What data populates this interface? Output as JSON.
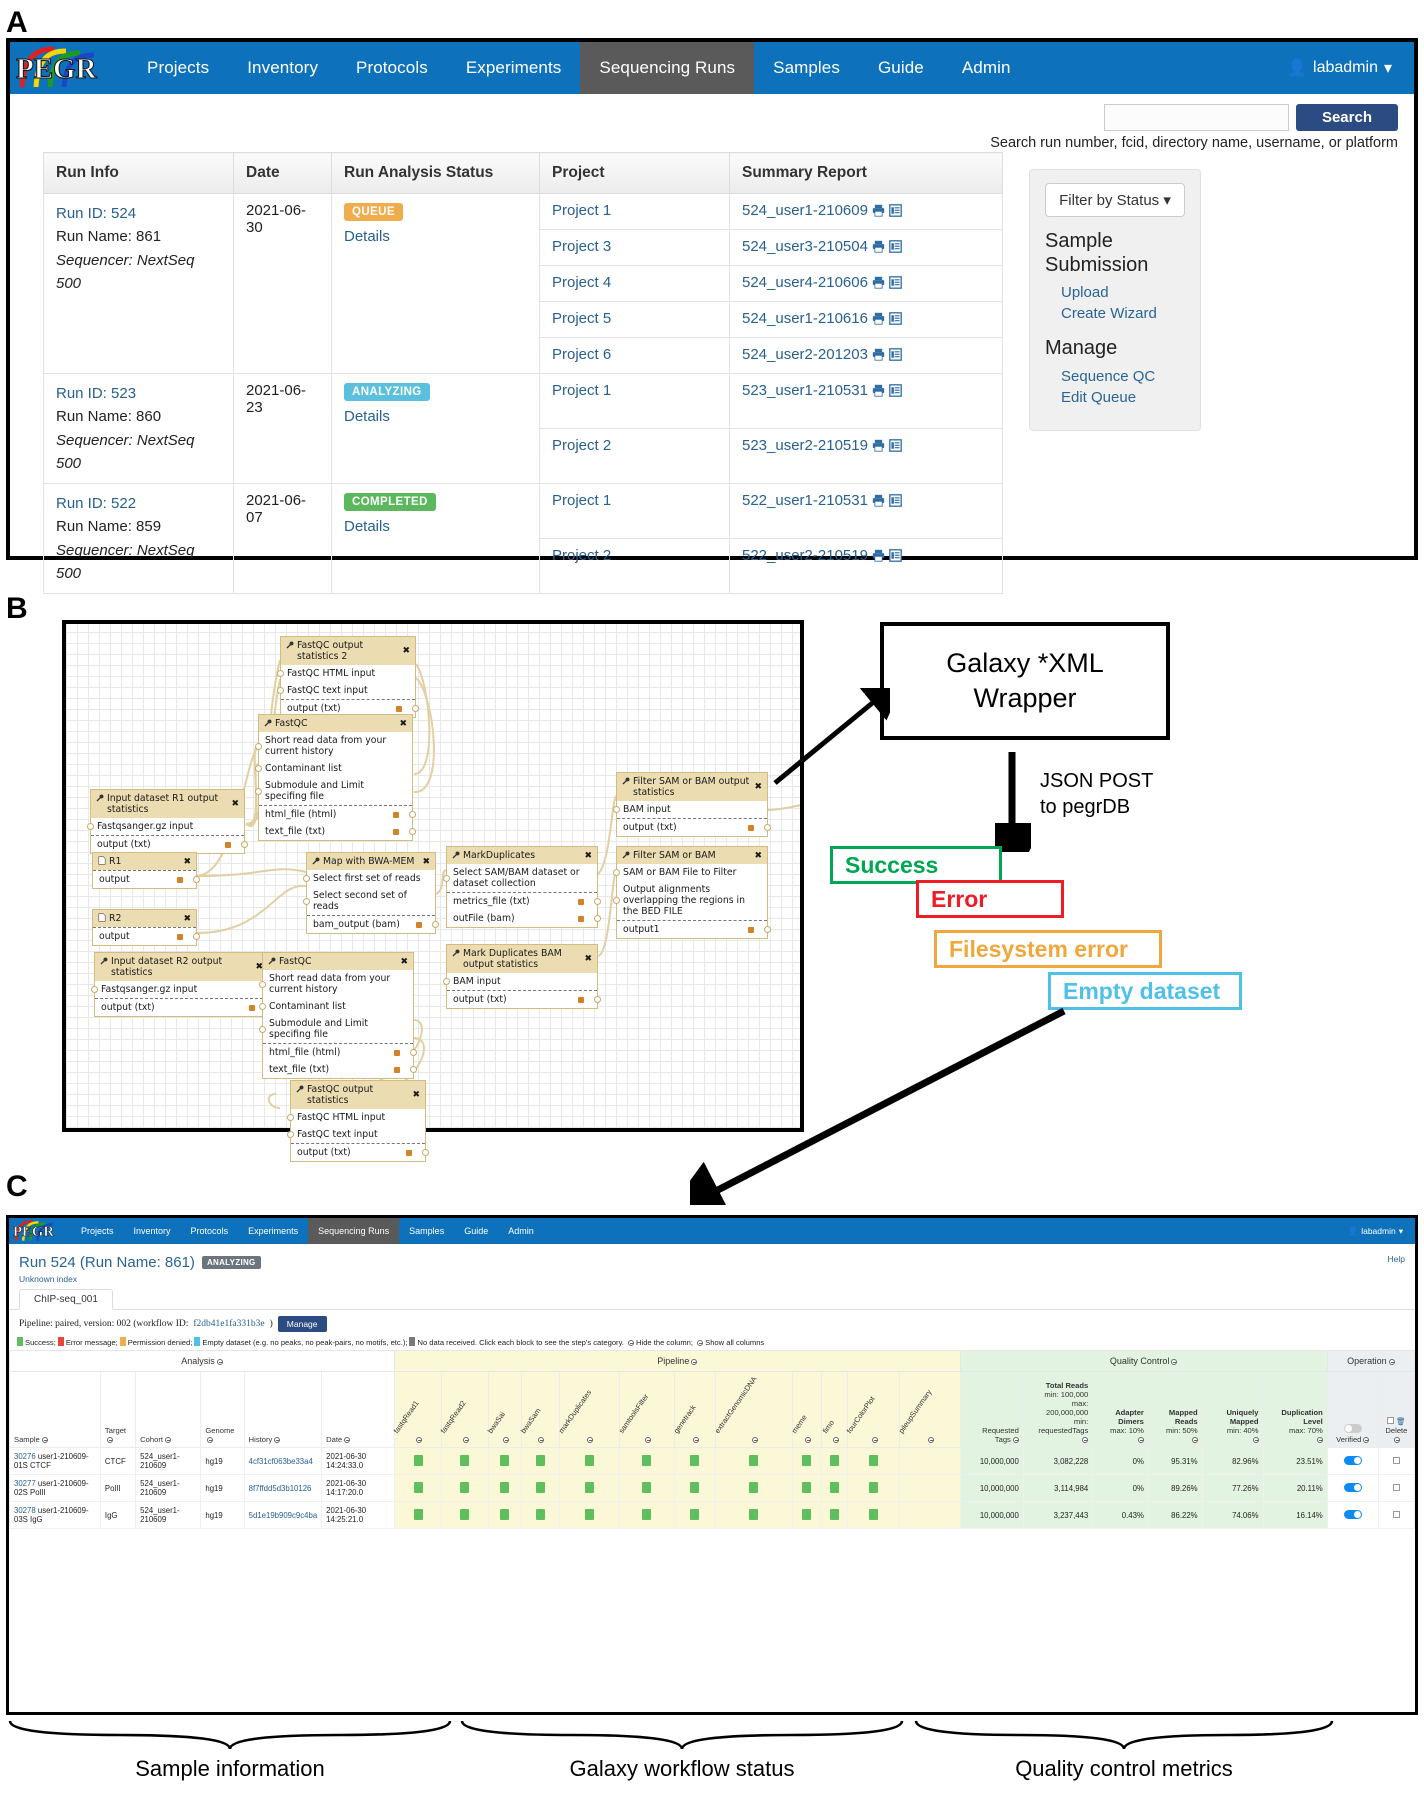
{
  "panels": {
    "a": "A",
    "b": "B",
    "c": "C"
  },
  "nav": {
    "brand": "PEGR",
    "items": [
      "Projects",
      "Inventory",
      "Protocols",
      "Experiments",
      "Sequencing Runs",
      "Samples",
      "Guide",
      "Admin"
    ],
    "active": "Sequencing Runs",
    "user": "labadmin",
    "user_icon": "user-icon",
    "caret_icon": "caret-down-icon"
  },
  "search": {
    "value": "",
    "placeholder": "",
    "button": "Search",
    "hint": "Search run number, fcid, directory name, username, or platform"
  },
  "runs_table": {
    "columns": [
      "Run Info",
      "Date",
      "Run Analysis Status",
      "Project",
      "Summary Report"
    ],
    "rows": [
      {
        "run_id": "Run ID: 524",
        "run_name": "Run Name: 861",
        "sequencer": "Sequencer: NextSeq 500",
        "date": "2021-06-30",
        "status": "QUEUE",
        "status_class": "queue",
        "details": "Details",
        "projects": [
          {
            "project": "Project 1",
            "report": "524_user1-210609"
          },
          {
            "project": "Project 3",
            "report": "524_user3-210504"
          },
          {
            "project": "Project 4",
            "report": "524_user4-210606"
          },
          {
            "project": "Project 5",
            "report": "524_user1-210616"
          },
          {
            "project": "Project 6",
            "report": "524_user2-201203"
          }
        ]
      },
      {
        "run_id": "Run ID: 523",
        "run_name": "Run Name: 860",
        "sequencer": "Sequencer: NextSeq 500",
        "date": "2021-06-23",
        "status": "ANALYZING",
        "status_class": "analyzing",
        "details": "Details",
        "projects": [
          {
            "project": "Project 1",
            "report": "523_user1-210531"
          },
          {
            "project": "Project 2",
            "report": "523_user2-210519"
          }
        ]
      },
      {
        "run_id": "Run ID: 522",
        "run_name": "Run Name: 859",
        "sequencer": "Sequencer: NextSeq 500",
        "date": "2021-06-07",
        "status": "COMPLETED",
        "status_class": "completed",
        "details": "Details",
        "projects": [
          {
            "project": "Project 1",
            "report": "522_user1-210531"
          },
          {
            "project": "Project 2",
            "report": "522_user2-210519"
          }
        ]
      }
    ],
    "row_icons": [
      "print-icon",
      "report-icon"
    ]
  },
  "sidebar": {
    "filter_label": "Filter by Status",
    "filter_caret": "caret-down-icon",
    "sections": [
      {
        "heading": "Sample Submission",
        "links": [
          "Upload",
          "Create Wizard"
        ]
      },
      {
        "heading": "Manage",
        "links": [
          "Sequence QC",
          "Edit Queue"
        ]
      }
    ]
  },
  "workflow": {
    "nodes": [
      {
        "id": "fastqc_out2",
        "title": "FastQC output statistics 2",
        "icon": "wrench-icon",
        "inputs": [
          "FastQC HTML input",
          "FastQC text input"
        ],
        "outputs": [
          "output (txt)"
        ]
      },
      {
        "id": "fastqc_top",
        "title": "FastQC",
        "icon": "wrench-icon",
        "inputs": [
          "Short read data from your current history",
          "Contaminant list",
          "Submodule and Limit specifing file"
        ],
        "outputs": [
          "html_file (html)",
          "text_file (txt)"
        ]
      },
      {
        "id": "r1_stats",
        "title": "Input dataset R1 output statistics",
        "icon": "wrench-icon",
        "inputs": [
          "Fastqsanger.gz input"
        ],
        "outputs": [
          "output (txt)"
        ]
      },
      {
        "id": "r1",
        "title": "R1",
        "icon": "file-icon",
        "inputs": [],
        "outputs": [
          "output"
        ]
      },
      {
        "id": "r2",
        "title": "R2",
        "icon": "file-icon",
        "inputs": [],
        "outputs": [
          "output"
        ]
      },
      {
        "id": "r2_stats",
        "title": "Input dataset R2 output statistics",
        "icon": "wrench-icon",
        "inputs": [
          "Fastqsanger.gz input"
        ],
        "outputs": [
          "output (txt)"
        ]
      },
      {
        "id": "bwa",
        "title": "Map with BWA-MEM",
        "icon": "wrench-icon",
        "inputs": [
          "Select first set of reads",
          "Select second set of reads"
        ],
        "outputs": [
          "bam_output (bam)"
        ]
      },
      {
        "id": "fastqc_bot",
        "title": "FastQC",
        "icon": "wrench-icon",
        "inputs": [
          "Short read data from your current history",
          "Contaminant list",
          "Submodule and Limit specifing file"
        ],
        "outputs": [
          "html_file (html)",
          "text_file (txt)"
        ]
      },
      {
        "id": "markdup",
        "title": "MarkDuplicates",
        "icon": "wrench-icon",
        "inputs": [
          "Select SAM/BAM dataset or dataset collection"
        ],
        "outputs": [
          "metrics_file (txt)",
          "outFile (bam)"
        ]
      },
      {
        "id": "markdup_stats",
        "title": "Mark Duplicates BAM output statistics",
        "icon": "wrench-icon",
        "inputs": [
          "BAM input"
        ],
        "outputs": [
          "output (txt)"
        ]
      },
      {
        "id": "filter_stats",
        "title": "Filter SAM or BAM output statistics",
        "icon": "wrench-icon",
        "inputs": [
          "BAM input"
        ],
        "outputs": [
          "output (txt)"
        ]
      },
      {
        "id": "filter",
        "title": "Filter SAM or BAM",
        "icon": "wrench-icon",
        "inputs": [
          "SAM or BAM File to Filter",
          "Output alignments overlapping the regions in the BED FILE"
        ],
        "outputs": [
          "output1"
        ]
      },
      {
        "id": "fastqc_out1",
        "title": "FastQC output statistics",
        "icon": "wrench-icon",
        "inputs": [
          "FastQC HTML input",
          "FastQC text input"
        ],
        "outputs": [
          "output (txt)"
        ]
      }
    ],
    "xml_box": "Galaxy *XML\nWrapper",
    "xml_box_line1": "Galaxy *XML",
    "xml_box_line2": "Wrapper",
    "json_label_line1": "JSON POST",
    "json_label_line2": "to pegrDB",
    "statuses": [
      {
        "label": "Success",
        "color": "#00a651"
      },
      {
        "label": "Error",
        "color": "#ee1c25"
      },
      {
        "label": "Filesystem error",
        "color": "#f0a83c"
      },
      {
        "label": "Empty dataset",
        "color": "#4fc1e9"
      }
    ]
  },
  "run_detail": {
    "title": "Run 524 (Run Name: 861)",
    "status_badge": "ANALYZING",
    "help": "Help",
    "unknown_index": "Unknown index",
    "tab": "ChIP-seq_001",
    "pipeline_prefix": "Pipeline: paired, version: 002 (workflow ID:",
    "workflow_id": "f2db41e1fa331b3e",
    "pipeline_suffix": ")",
    "manage": "Manage",
    "legend": [
      {
        "color": "#5fbf5f",
        "text": "Success;"
      },
      {
        "color": "#e8453c",
        "text": "Error message;"
      },
      {
        "color": "#f0ad4e",
        "text": "Permission denied;"
      },
      {
        "color": "#4fc1e9",
        "text": "Empty dataset (e.g. no peaks, no peak-pairs, no motifs, etc.);"
      },
      {
        "color": "#7a7a7a",
        "text": "No data received. Click each block to see the step's category."
      }
    ],
    "hide_column": "Hide the column;",
    "show_all_columns": "Show all columns",
    "group_headers": [
      "Analysis",
      "Pipeline",
      "Quality Control",
      "Operation"
    ],
    "analysis_columns": [
      "Sample",
      "Target",
      "Cohort",
      "Genome",
      "History",
      "Date"
    ],
    "pipeline_columns": [
      "fastqRead1",
      "fastqRead2",
      "bwaSai",
      "bwaSam",
      "markDuplicates",
      "samtoolsFilter",
      "genetrack",
      "extractGenomicDNA",
      "meme",
      "fimo",
      "fourColorPlot",
      "pileupSummary"
    ],
    "qc_columns": [
      {
        "label": "Requested Tags",
        "limits": []
      },
      {
        "label": "Total Reads",
        "limits": [
          "min: 100,000",
          "max: 200,000,000",
          "min: requestedTags"
        ]
      },
      {
        "label": "Adapter Dimers",
        "limits": [
          "max: 10%"
        ]
      },
      {
        "label": "Mapped Reads",
        "limits": [
          "min: 50%"
        ]
      },
      {
        "label": "Uniquely Mapped",
        "limits": [
          "min: 40%"
        ]
      },
      {
        "label": "Duplication Level",
        "limits": [
          "max: 70%"
        ]
      }
    ],
    "operation_columns": [
      "Verified",
      "Delete"
    ],
    "rows": [
      {
        "id": "30276",
        "sample": "user1-210609-01S CTCF",
        "target": "CTCF",
        "cohort": "524_user1-210609",
        "genome": "hg19",
        "history": "4cf31cf063be33a4",
        "date": "2021-06-30 14:24:33.0",
        "blocks": 11,
        "requested_tags": "10,000,000",
        "total_reads": "3,082,228",
        "adapter_dimers": "0%",
        "mapped_reads": "95.31%",
        "uniquely_mapped": "82.96%",
        "duplication_level": "23.51%",
        "verified": true
      },
      {
        "id": "30277",
        "sample": "user1-210609-02S PolII",
        "target": "PolII",
        "cohort": "524_user1-210609",
        "genome": "hg19",
        "history": "8f7ffdd5d3b10126",
        "date": "2021-06-30 14:17:20.0",
        "blocks": 11,
        "requested_tags": "10,000,000",
        "total_reads": "3,114,984",
        "adapter_dimers": "0%",
        "mapped_reads": "89.26%",
        "uniquely_mapped": "77.26%",
        "duplication_level": "20.11%",
        "verified": true
      },
      {
        "id": "30278",
        "sample": "user1-210609-03S IgG",
        "target": "IgG",
        "cohort": "524_user1-210609",
        "genome": "hg19",
        "history": "5d1e19b909c9c4ba",
        "date": "2021-06-30 14:25:21.0",
        "blocks": 11,
        "requested_tags": "10,000,000",
        "total_reads": "3,237,443",
        "adapter_dimers": "0.43%",
        "mapped_reads": "86.22%",
        "uniquely_mapped": "74.06%",
        "duplication_level": "16.14%",
        "verified": true
      }
    ]
  },
  "braces": [
    {
      "label": "Sample information"
    },
    {
      "label": "Galaxy workflow status"
    },
    {
      "label": "Quality control metrics"
    }
  ]
}
